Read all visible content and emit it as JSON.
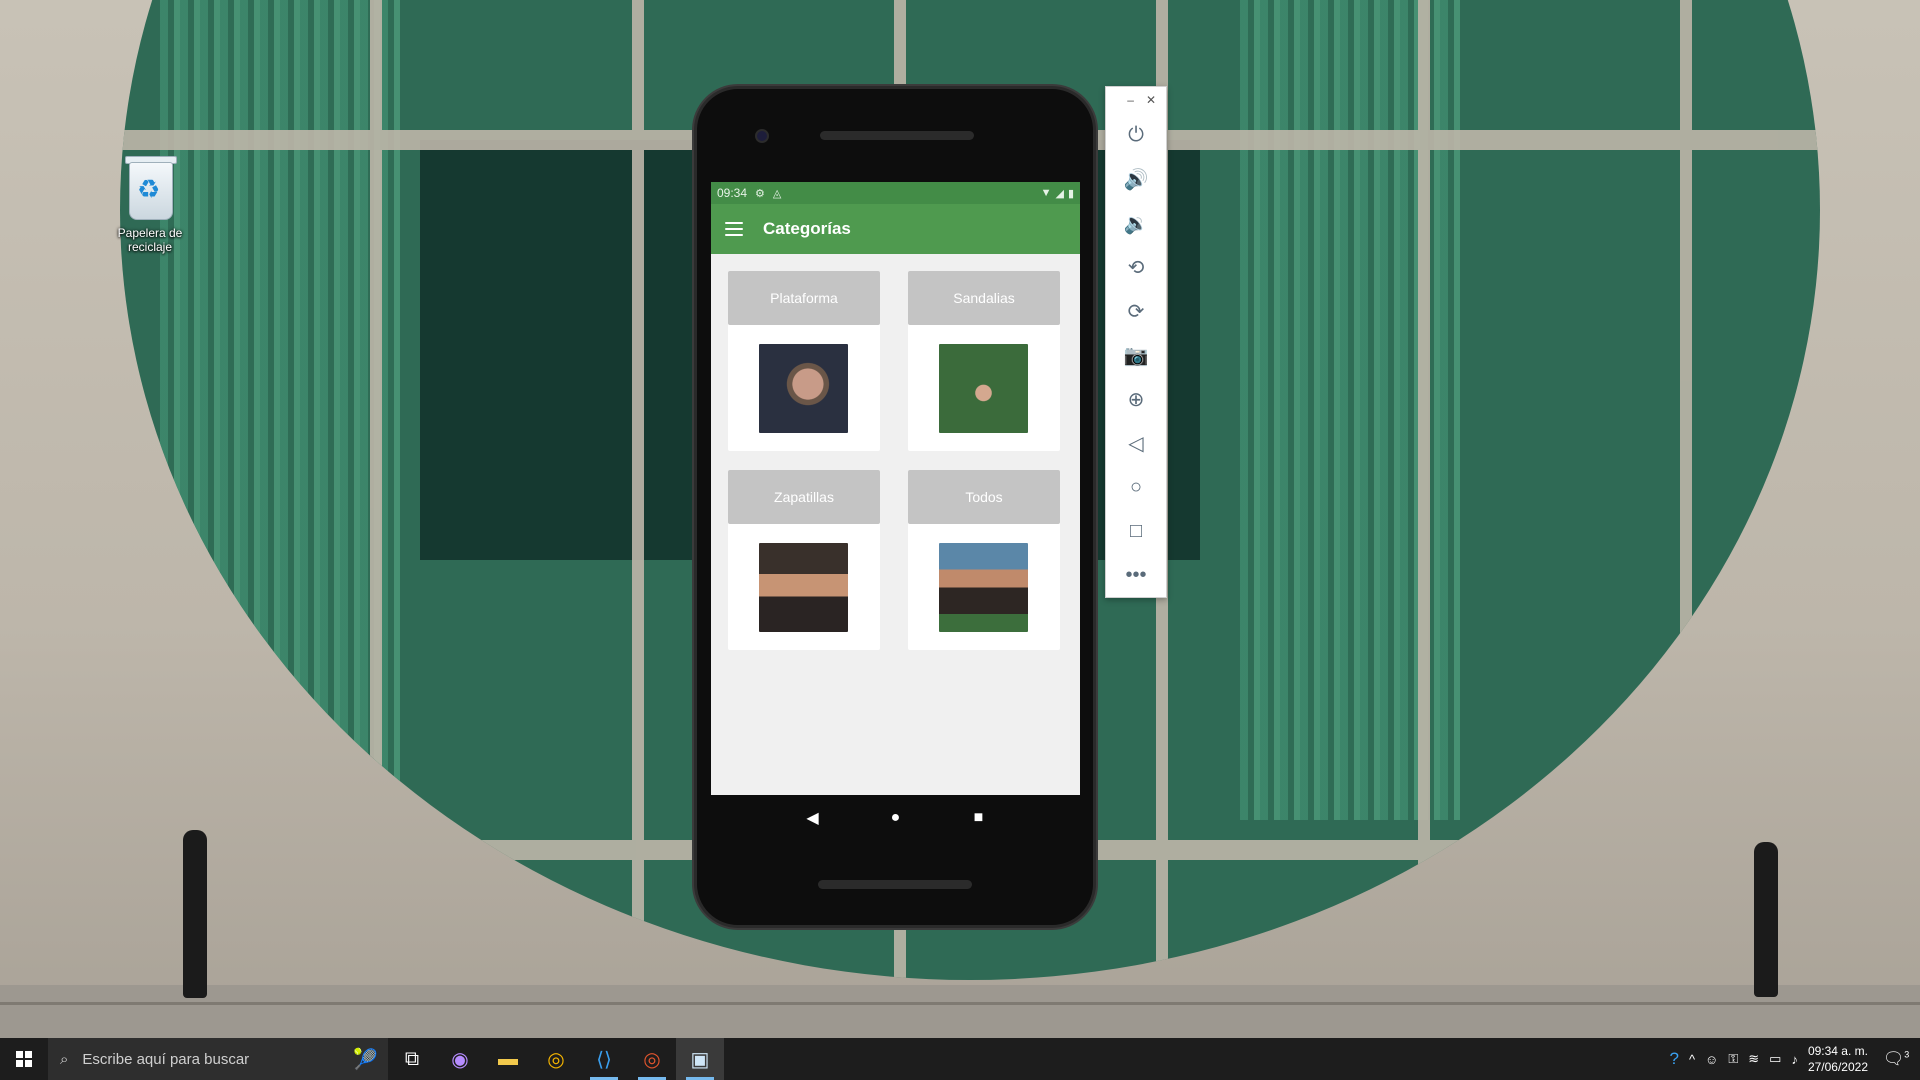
{
  "desktop": {
    "icon_label": "Papelera de reciclaje"
  },
  "phone": {
    "status": {
      "time": "09:34"
    },
    "app_title": "Categorías",
    "categories": [
      {
        "label": "Plataforma"
      },
      {
        "label": "Sandalias"
      },
      {
        "label": "Zapatillas"
      },
      {
        "label": "Todos"
      }
    ],
    "colors": {
      "status_bar": "#438c47",
      "app_bar": "#4f9a4f",
      "category_button": "#c4c4c4"
    }
  },
  "emulator_toolbar": {
    "buttons": [
      "power-icon",
      "volume-up-icon",
      "volume-down-icon",
      "rotate-left-icon",
      "rotate-right-icon",
      "camera-icon",
      "zoom-icon",
      "back-icon",
      "home-icon",
      "overview-icon",
      "more-icon"
    ]
  },
  "taskbar": {
    "search_placeholder": "Escribe aquí para buscar",
    "clock_time": "09:34 a. m.",
    "clock_date": "27/06/2022",
    "notification_count": "3"
  }
}
